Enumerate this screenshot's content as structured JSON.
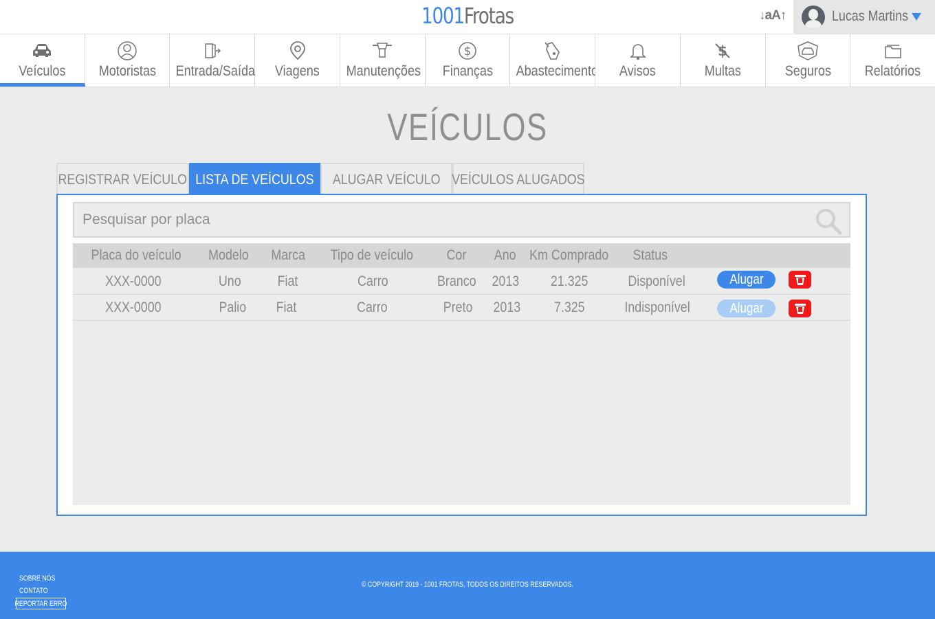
{
  "header": {
    "logo_number": "1001",
    "logo_name": "Frotas",
    "font_size_control": "↓aA↑",
    "user_name": "Lucas Martins"
  },
  "nav": {
    "items": [
      {
        "label": "Veículos",
        "icon": "car-icon"
      },
      {
        "label": "Motoristas",
        "icon": "driver-icon"
      },
      {
        "label": "Entrada/Saída",
        "icon": "entry-exit-icon"
      },
      {
        "label": "Viagens",
        "icon": "map-pin-icon"
      },
      {
        "label": "Manutenções",
        "icon": "wrench-icon"
      },
      {
        "label": "Finanças",
        "icon": "dollar-icon"
      },
      {
        "label": "Abastecimento",
        "icon": "fuel-pump-icon"
      },
      {
        "label": "Avisos",
        "icon": "bell-icon"
      },
      {
        "label": "Multas",
        "icon": "fine-icon"
      },
      {
        "label": "Seguros",
        "icon": "insurance-icon"
      },
      {
        "label": "Relatórios",
        "icon": "folder-icon"
      }
    ],
    "active_index": 0
  },
  "page": {
    "title": "VEÍCULOS"
  },
  "tabs": [
    {
      "label": "REGISTRAR VEÍCULO"
    },
    {
      "label": "LISTA DE VEÍCULOS"
    },
    {
      "label": "ALUGAR VEÍCULO"
    },
    {
      "label": "VEÍCULOS ALUGADOS"
    }
  ],
  "active_tab": 1,
  "search": {
    "placeholder": "Pesquisar por placa",
    "value": ""
  },
  "table": {
    "headers": {
      "plate": "Placa do veículo",
      "model": "Modelo",
      "brand": "Marca",
      "type": "Tipo de veículo",
      "color": "Cor",
      "year": "Ano",
      "km": "Km Comprado",
      "status": "Status"
    },
    "rows": [
      {
        "plate": "XXX-0000",
        "model": "Uno",
        "brand": "Fiat",
        "type": "Carro",
        "color": "Branco",
        "year": "2013",
        "km": "21.325",
        "status": "Disponível",
        "rent_label": "Alugar",
        "rent_enabled": true
      },
      {
        "plate": "XXX-0000",
        "model": "Palio",
        "brand": "Fiat",
        "type": "Carro",
        "color": "Preto",
        "year": "2013",
        "km": "7.325",
        "status": "Indisponível",
        "rent_label": "Alugar",
        "rent_enabled": false
      }
    ]
  },
  "footer": {
    "about": "SOBRE NÓS",
    "contact": "CONTATO",
    "report_error": "REPORTAR ERRO",
    "copyright": "© COPYRIGHT 2019 - 1001 FROTAS, TODOS OS DIREITOS RESERVADOS."
  },
  "colors": {
    "accent": "#3d87e8",
    "accent_disabled": "#a8cdf5",
    "danger": "#f01a1a",
    "background": "#ececec"
  }
}
